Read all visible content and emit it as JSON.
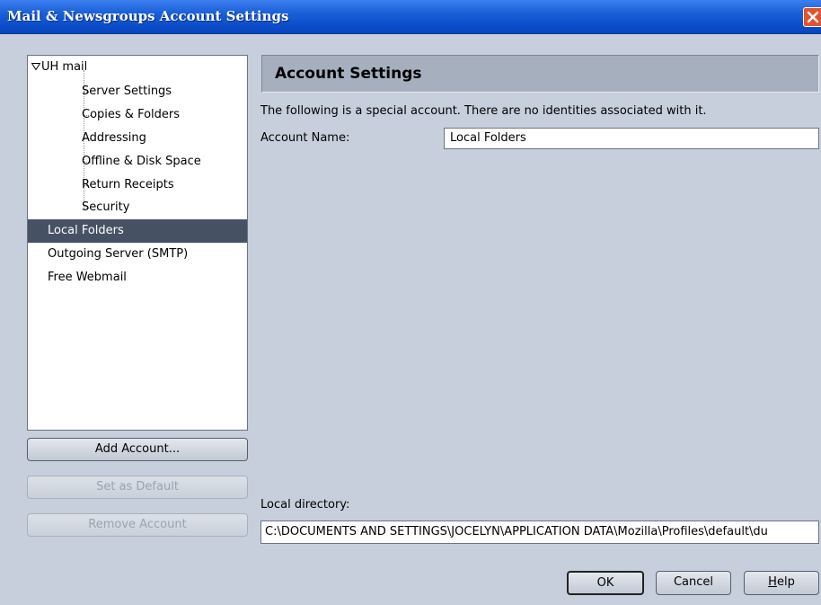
{
  "window": {
    "title": "Mail & Newsgroups Account Settings",
    "title_color": "#ffffff",
    "titlebar_color": "#0b4cc9",
    "close_icon": "close-icon"
  },
  "tree": {
    "account": "UH mail",
    "children": [
      "Server Settings",
      "Copies & Folders",
      "Addressing",
      "Offline & Disk Space",
      "Return Receipts",
      "Security"
    ],
    "items": [
      "Local Folders",
      "Outgoing Server (SMTP)",
      "Free Webmail"
    ],
    "selected": "Local Folders",
    "selected_color": "#465264"
  },
  "left_buttons": {
    "add_account": "Add Account...",
    "set_default": "Set as Default",
    "remove_account": "Remove Account"
  },
  "panel": {
    "header": "Account Settings",
    "info": "The following is a special account. There are no identities associated with it.",
    "account_name_label": "Account Name:",
    "account_name_value": "Local Folders",
    "local_directory_label": "Local directory:",
    "local_directory_value": "C:\\DOCUMENTS AND SETTINGS\\JOCELYN\\APPLICATION DATA\\Mozilla\\Profiles\\default\\du"
  },
  "dialog_buttons": {
    "ok": "OK",
    "cancel": "Cancel",
    "help_accesskey": "H",
    "help_rest": "elp"
  }
}
